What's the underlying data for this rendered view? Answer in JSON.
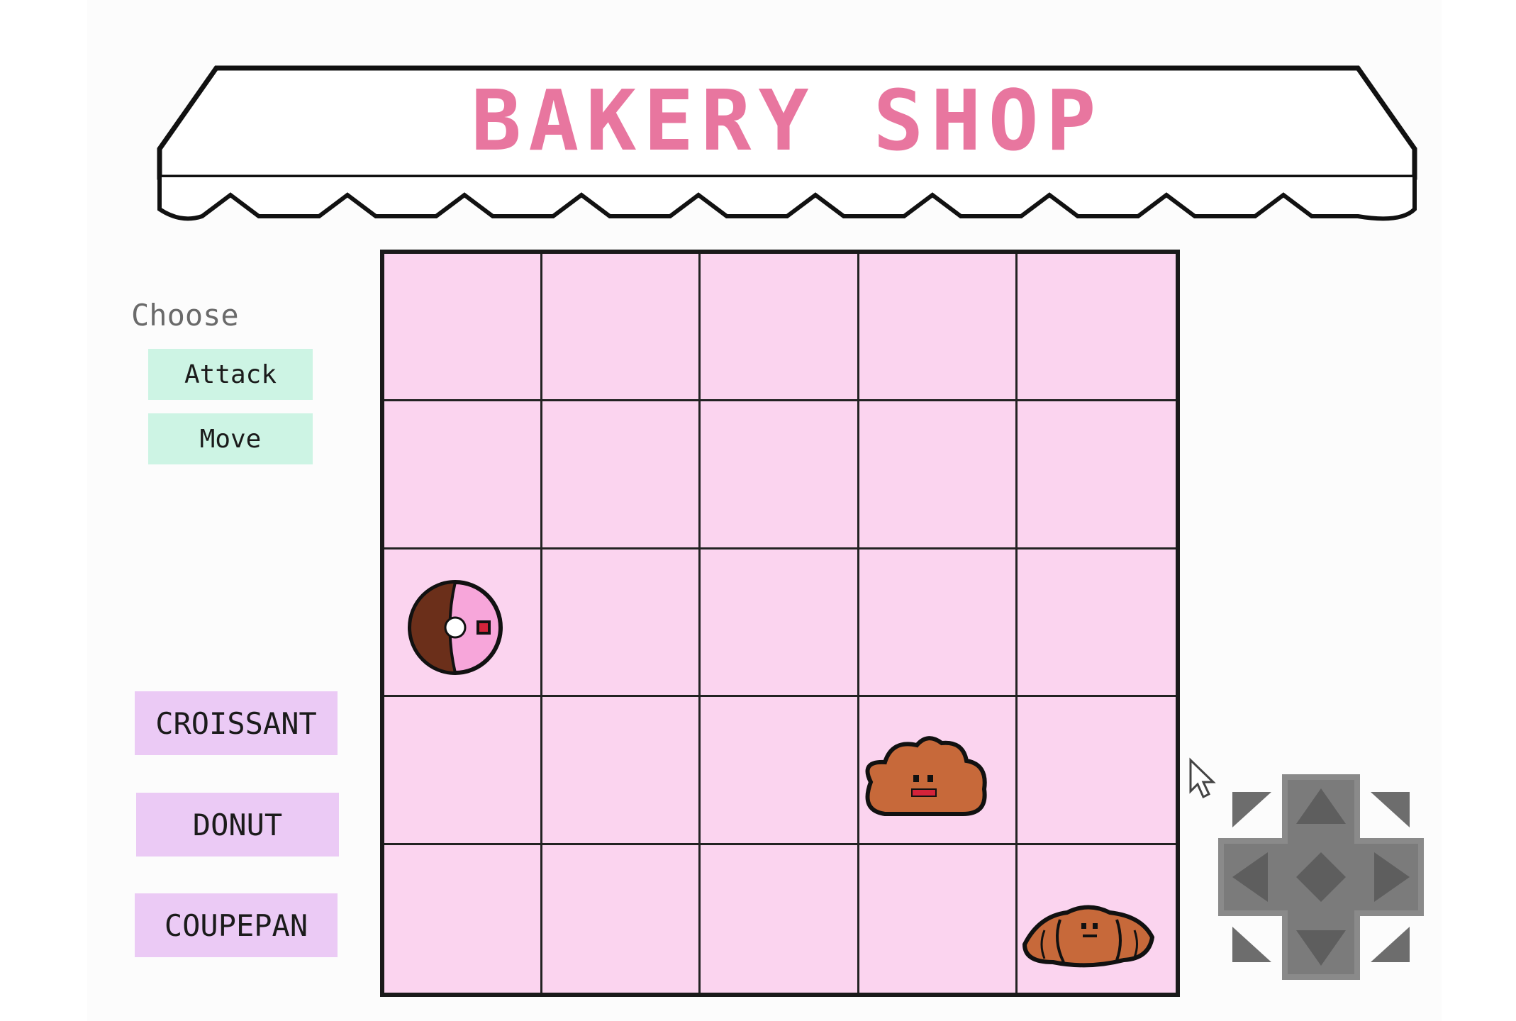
{
  "title": "BAKERY SHOP",
  "panel": {
    "choose_label": "Choose",
    "actions": [
      {
        "label": "Attack"
      },
      {
        "label": "Move"
      }
    ]
  },
  "units": [
    {
      "label": "CROISSANT"
    },
    {
      "label": "DONUT"
    },
    {
      "label": "COUPEPAN"
    }
  ],
  "board": {
    "rows": 5,
    "cols": 5,
    "pieces": [
      {
        "name": "donut",
        "row": 3,
        "col": 1
      },
      {
        "name": "coupepan",
        "row": 4,
        "col": 4
      },
      {
        "name": "croissant",
        "row": 5,
        "col": 5
      }
    ]
  },
  "colors": {
    "title": "#e8769f",
    "board": "#fbd4ef",
    "action_button": "#cdf4e4",
    "unit_button": "#ebcaf5"
  },
  "controls": {
    "dpad_icon": "dpad-icon"
  }
}
